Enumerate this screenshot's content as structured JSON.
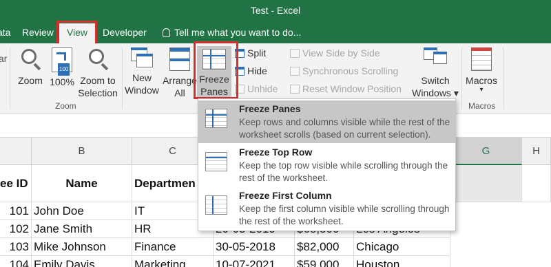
{
  "window": {
    "title": "Test - Excel"
  },
  "tabs": [
    "ata",
    "Review",
    "View",
    "Developer"
  ],
  "tell_me": "Tell me what you want to do...",
  "ribbon": {
    "left_partial": "ar",
    "zoom_group": {
      "label": "Zoom",
      "zoom": "Zoom",
      "hundred": "100%",
      "zoom_to_sel_1": "Zoom to",
      "zoom_to_sel_2": "Selection"
    },
    "window_group": {
      "new_window_1": "New",
      "new_window_2": "Window",
      "arrange_all_1": "Arrange",
      "arrange_all_2": "All",
      "freeze_1": "Freeze",
      "freeze_2": "Panes ▾",
      "split": "Split",
      "hide": "Hide",
      "unhide": "Unhide",
      "side_by_side": "View Side by Side",
      "sync_scroll": "Synchronous Scrolling",
      "reset_pos": "Reset Window Position",
      "switch_1": "Switch",
      "switch_2": "Windows ▾"
    },
    "macros_group": {
      "label": "Macros",
      "macros": "Macros",
      "macros_arrow": "▾"
    }
  },
  "freeze_menu": [
    {
      "title": "Freeze Panes",
      "desc": "Keep rows and columns visible while the rest of the worksheet scrolls (based on current selection).",
      "icon": "freeze-panes-icon"
    },
    {
      "title": "Freeze Top Row",
      "desc": "Keep the top row visible while scrolling through the rest of the worksheet.",
      "icon": "freeze-top-row-icon"
    },
    {
      "title": "Freeze First Column",
      "desc": "Keep the first column visible while scrolling through the rest of the worksheet.",
      "icon": "freeze-first-column-icon"
    }
  ],
  "grid": {
    "columns": [
      "B",
      "C",
      "G",
      "H"
    ],
    "header_row": [
      "ee ID",
      "Name",
      "Departmen"
    ],
    "rows": [
      [
        "101",
        "John Doe",
        "IT",
        "",
        "",
        ""
      ],
      [
        "102",
        "Jane Smith",
        "HR",
        "20-03-2019",
        "$68,500",
        "Los Angeles"
      ],
      [
        "103",
        "Mike Johnson",
        "Finance",
        "30-05-2018",
        "$82,000",
        "Chicago"
      ],
      [
        "104",
        "Emily Davis",
        "Marketing",
        "10-07-2021",
        "$59,000",
        "Houston"
      ]
    ]
  },
  "colors": {
    "accent": "#217346",
    "highlight_box": "#d32f2f"
  }
}
